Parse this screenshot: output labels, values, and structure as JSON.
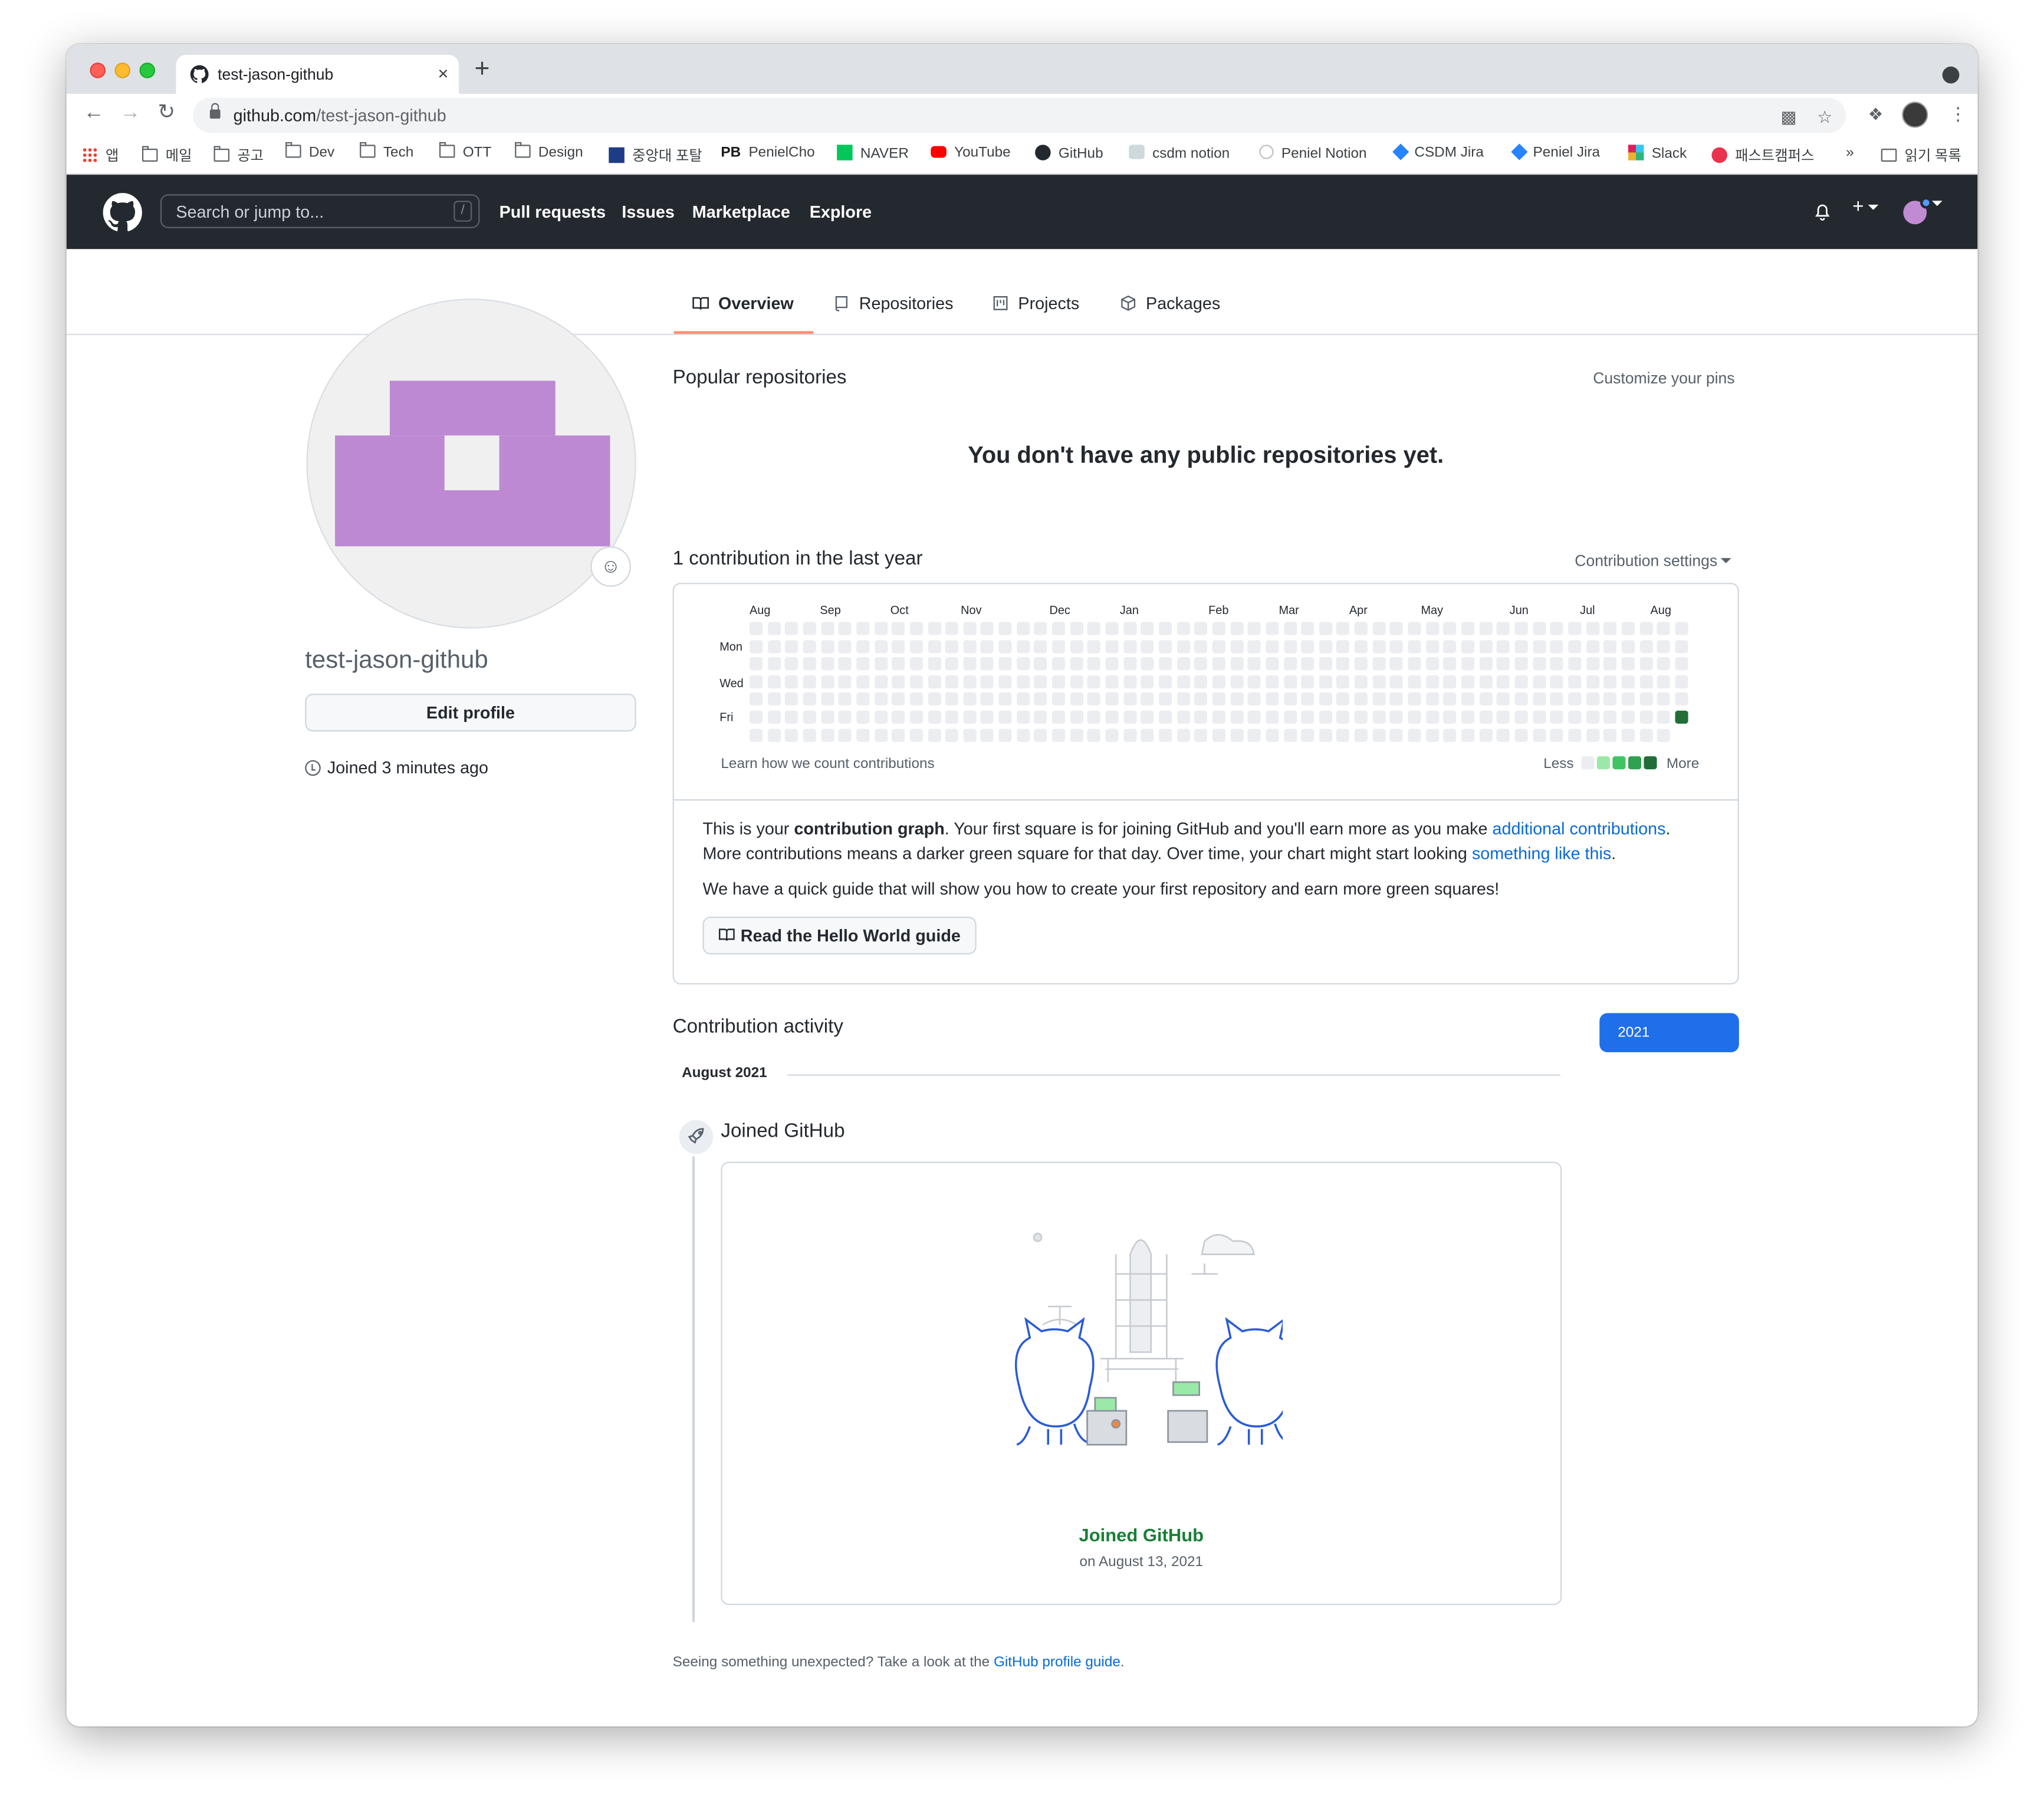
{
  "browser": {
    "tab_title": "test-jason-github",
    "tab_close": "×",
    "new_tab": "+",
    "url_host": "github.com",
    "url_path": "/test-jason-github",
    "bookmarks": [
      "앱",
      "메일",
      "공고",
      "Dev",
      "Tech",
      "OTT",
      "Design",
      "중앙대 포탈",
      "PenielCho",
      "NAVER",
      "YouTube",
      "GitHub",
      "csdm notion",
      "Peniel Notion",
      "CSDM Jira",
      "Peniel Jira",
      "Slack",
      "패스트캠퍼스"
    ],
    "more_bookmarks": "»",
    "reading_list": "읽기 목록"
  },
  "header": {
    "search_placeholder": "Search or jump to...",
    "search_key": "/",
    "nav": [
      "Pull requests",
      "Issues",
      "Marketplace",
      "Explore"
    ],
    "plus": "+"
  },
  "tabs": [
    "Overview",
    "Repositories",
    "Projects",
    "Packages"
  ],
  "profile": {
    "username": "test-jason-github",
    "edit_button": "Edit profile",
    "joined": "Joined 3 minutes ago",
    "avatar_color": "#bd89d3"
  },
  "popular": {
    "heading": "Popular repositories",
    "customize": "Customize your pins",
    "empty": "You don't have any public repositories yet."
  },
  "contributions": {
    "heading": "1 contribution in the last year",
    "settings": "Contribution settings",
    "months": [
      "Aug",
      "Sep",
      "Oct",
      "Nov",
      "Dec",
      "Jan",
      "Feb",
      "Mar",
      "Apr",
      "May",
      "Jun",
      "Jul",
      "Aug"
    ],
    "weekdays": [
      "Mon",
      "Wed",
      "Fri"
    ],
    "learn": "Learn how we count contributions",
    "less": "Less",
    "more": "More",
    "levels": [
      "#ebedf0",
      "#9be9a8",
      "#40c463",
      "#30a14e",
      "#216e39"
    ],
    "active_day": "Friday, August 13, 2021",
    "active_count": 1,
    "explain_1": "This is your ",
    "explain_bold": "contribution graph",
    "explain_2": ". Your first square is for joining GitHub and you'll earn more as you make ",
    "explain_link1": "additional contributions",
    "explain_3": ". More contributions means a darker green square for that day. Over time, your chart might start looking ",
    "explain_link2": "something like this",
    "explain_4": ".",
    "guide_text": "We have a quick guide that will show you how to create your first repository and earn more green squares!",
    "guide_button": "Read the Hello World guide"
  },
  "activity": {
    "heading": "Contribution activity",
    "year": "2021",
    "month": "August 2021",
    "event": "Joined GitHub",
    "card_title": "Joined GitHub",
    "card_date": "on August 13, 2021"
  },
  "footer": {
    "text": "Seeing something unexpected? Take a look at the ",
    "link": "GitHub profile guide",
    "end": "."
  }
}
